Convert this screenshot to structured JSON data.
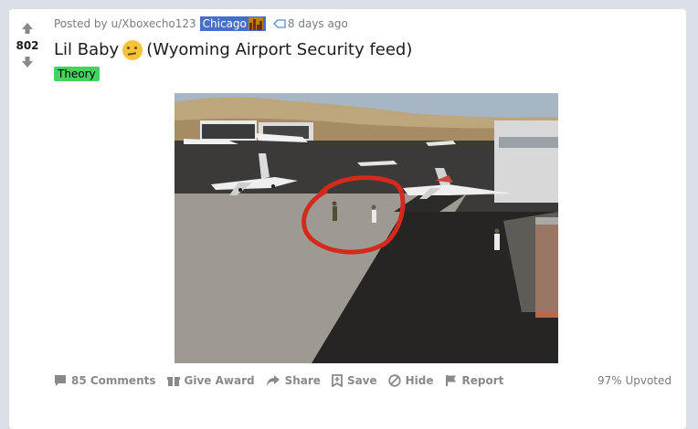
{
  "post": {
    "score": "802",
    "posted_by_prefix": "Posted by",
    "username": "u/Xboxecho123",
    "user_flair": "Chicago",
    "time": "8 days ago",
    "title_part1": "Lil Baby",
    "title_part2": "(Wyoming Airport Security feed)",
    "post_flair": "Theory",
    "post_flair_color": "#46d160"
  },
  "actions": {
    "comments": "85 Comments",
    "give_award": "Give Award",
    "share": "Share",
    "save": "Save",
    "hide": "Hide",
    "report": "Report",
    "upvoted": "97% Upvoted"
  },
  "colors": {
    "background": "#dae0e6",
    "card": "#ffffff",
    "chicago_flair": "#4a6ec7",
    "annotation_circle": "#d42a1e"
  }
}
